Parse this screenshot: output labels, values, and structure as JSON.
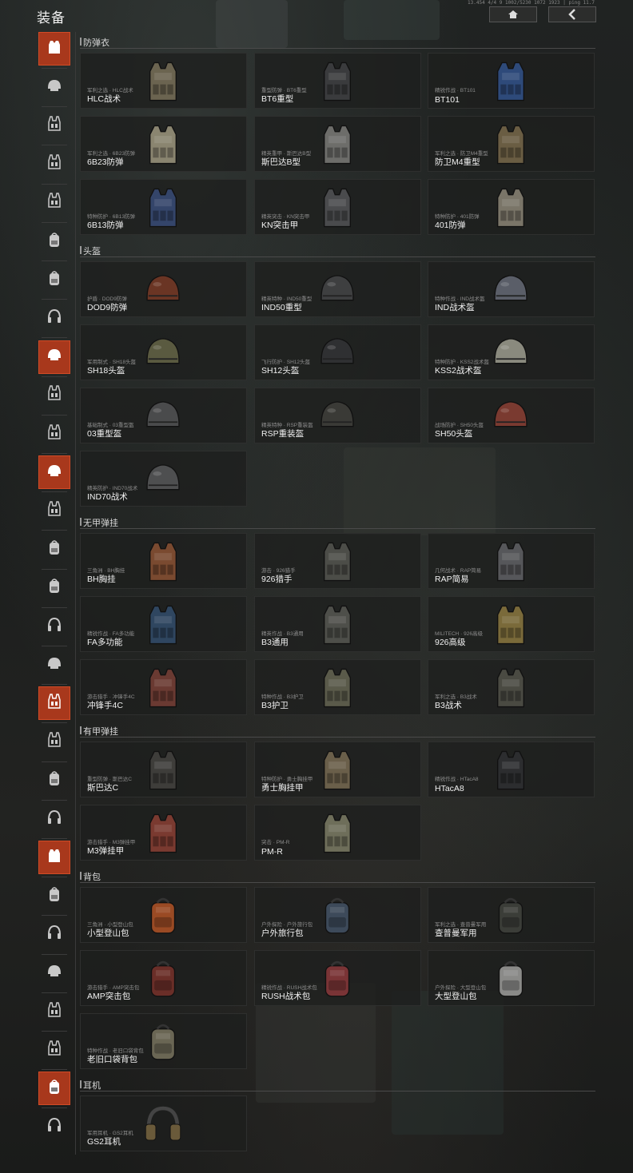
{
  "header": {
    "title": "装备",
    "status_text": "13.454 4/4 9 1002/5230 1072 1923 | ping 11.7"
  },
  "nav": {
    "home_icon": "home-icon",
    "back_icon": "back-arrow-icon"
  },
  "colors": {
    "accent": "#a8381c",
    "accent_border": "#d24b26",
    "panel": "#1e1f1e"
  },
  "sidebar": [
    {
      "icon": "vest-icon",
      "active": true
    },
    {
      "icon": "helmet-icon",
      "active": false
    },
    {
      "icon": "rig-icon",
      "active": false
    },
    {
      "icon": "rig-icon",
      "active": false
    },
    {
      "icon": "rig-icon",
      "active": false
    },
    {
      "icon": "backpack-icon",
      "active": false
    },
    {
      "icon": "backpack-icon",
      "active": false
    },
    {
      "icon": "headset-icon",
      "active": false
    },
    {
      "icon": "helmet-icon",
      "active": true
    },
    {
      "icon": "rig-icon",
      "active": false
    },
    {
      "icon": "rig-icon",
      "active": false
    },
    {
      "icon": "helmet-icon",
      "active": true
    },
    {
      "icon": "rig-icon",
      "active": false
    },
    {
      "icon": "backpack-icon",
      "active": false
    },
    {
      "icon": "backpack-icon",
      "active": false
    },
    {
      "icon": "headset-icon",
      "active": false
    },
    {
      "icon": "helmet-icon",
      "active": false
    },
    {
      "icon": "rig-icon",
      "active": true
    },
    {
      "icon": "rig-icon",
      "active": false
    },
    {
      "icon": "backpack-icon",
      "active": false
    },
    {
      "icon": "headset-icon",
      "active": false
    },
    {
      "icon": "vest-icon",
      "active": true
    },
    {
      "icon": "backpack-icon",
      "active": false
    },
    {
      "icon": "headset-icon",
      "active": false
    },
    {
      "icon": "helmet-icon",
      "active": false
    },
    {
      "icon": "rig-icon",
      "active": false
    },
    {
      "icon": "rig-icon",
      "active": false
    },
    {
      "icon": "backpack-icon",
      "active": true
    },
    {
      "icon": "headset-icon",
      "active": false
    }
  ],
  "sections": [
    {
      "title": "防弹衣",
      "items": [
        {
          "sub": "军利之选 · HLC战术",
          "name": "HLC战术",
          "color": "#6b6450"
        },
        {
          "sub": "重型防弹 · BT6重型",
          "name": "BT6重型",
          "color": "#3a3b3d"
        },
        {
          "sub": "精锐作战 · BT101",
          "name": "BT101",
          "color": "#2e4a7a"
        },
        {
          "sub": "军利之选 · 6B23防弹",
          "name": "6B23防弹",
          "color": "#8a8570"
        },
        {
          "sub": "精英重甲 · 斯巴达B型",
          "name": "斯巴达B型",
          "color": "#6d6d6a"
        },
        {
          "sub": "军利之选 · 防卫M4重型",
          "name": "防卫M4重型",
          "color": "#6a5d43"
        },
        {
          "sub": "特种防护 · 6B13防弹",
          "name": "6B13防弹",
          "color": "#34456a"
        },
        {
          "sub": "精英突击 · KN突击甲",
          "name": "KN突击甲",
          "color": "#4a4b4d"
        },
        {
          "sub": "特种防护 · 401防弹",
          "name": "401防弹",
          "color": "#7a7568"
        }
      ]
    },
    {
      "title": "头盔",
      "items": [
        {
          "sub": "护盾 · DOD9防弹",
          "name": "DOD9防弹",
          "color": "#6a3524"
        },
        {
          "sub": "精英特种 · IND50重型",
          "name": "IND50重型",
          "color": "#3e3f40"
        },
        {
          "sub": "特种作战 · IND战术盔",
          "name": "IND战术盔",
          "color": "#5a5e68"
        },
        {
          "sub": "军用制式 · SH18头盔",
          "name": "SH18头盔",
          "color": "#5a5a40"
        },
        {
          "sub": "飞行防护 · SH12头盔",
          "name": "SH12头盔",
          "color": "#2f3032"
        },
        {
          "sub": "特种防护 · KSS2战术盔",
          "name": "KSS2战术盔",
          "color": "#8a8a7e"
        },
        {
          "sub": "基础制式 · 03重型盔",
          "name": "03重型盔",
          "color": "#4a4b4c"
        },
        {
          "sub": "精英特种 · RSP重装盔",
          "name": "RSP重装盔",
          "color": "#3a3a36"
        },
        {
          "sub": "战场防护 · SH50头盔",
          "name": "SH50头盔",
          "color": "#7a3a30"
        },
        {
          "sub": "精英防护 · IND70战术",
          "name": "IND70战术",
          "color": "#4e4f50"
        }
      ]
    },
    {
      "title": "无甲弹挂",
      "items": [
        {
          "sub": "三角洲 · BH胸挂",
          "name": "BH胸挂",
          "color": "#7a4a30"
        },
        {
          "sub": "游击 · 926猎手",
          "name": "926猎手",
          "color": "#4c4d48"
        },
        {
          "sub": "几何战术 · RAP简易",
          "name": "RAP简易",
          "color": "#56575a"
        },
        {
          "sub": "精锐作战 · FA多功能",
          "name": "FA多功能",
          "color": "#2f4660"
        },
        {
          "sub": "精英作战 · B3通用",
          "name": "B3通用",
          "color": "#4e4f4a"
        },
        {
          "sub": "MILITECH · 926高级",
          "name": "926高级",
          "color": "#7a6a3a"
        },
        {
          "sub": "游击猎手 · 冲锋手4C",
          "name": "冲锋手4C",
          "color": "#6a3a32"
        },
        {
          "sub": "特种作战 · B3护卫",
          "name": "B3护卫",
          "color": "#5a5a4a"
        },
        {
          "sub": "军利之选 · B3战术",
          "name": "B3战术",
          "color": "#4a4a42"
        }
      ]
    },
    {
      "title": "有甲弹挂",
      "items": [
        {
          "sub": "重型防弹 · 斯巴达C",
          "name": "斯巴达C",
          "color": "#3e3d3a"
        },
        {
          "sub": "特种防护 · 勇士胸挂甲",
          "name": "勇士胸挂甲",
          "color": "#6a5f4a"
        },
        {
          "sub": "精锐作战 · HTacA8",
          "name": "HTacA8",
          "color": "#2c2d2f"
        },
        {
          "sub": "游击猎手 · M3弹挂甲",
          "name": "M3弹挂甲",
          "color": "#7a3a30"
        },
        {
          "sub": "突击 · PM-R",
          "name": "PM-R",
          "color": "#6e6e5a"
        }
      ]
    },
    {
      "title": "背包",
      "items": [
        {
          "sub": "三角洲 · 小型登山包",
          "name": "小型登山包",
          "color": "#9a4a24"
        },
        {
          "sub": "户外探险 · 户外旅行包",
          "name": "户外旅行包",
          "color": "#3d4a5a"
        },
        {
          "sub": "军利之选 · 查普曼军用",
          "name": "查普曼军用",
          "color": "#3b3d38"
        },
        {
          "sub": "游击猎手 · AMP突击包",
          "name": "AMP突击包",
          "color": "#6a2e28"
        },
        {
          "sub": "精锐作战 · RUSH战术包",
          "name": "RUSH战术包",
          "color": "#7a3436"
        },
        {
          "sub": "户外探险 · 大型登山包",
          "name": "大型登山包",
          "color": "#8a8a88"
        },
        {
          "sub": "特种作战 · 老旧口袋背包",
          "name": "老旧口袋背包",
          "color": "#6a6654"
        }
      ]
    },
    {
      "title": "耳机",
      "items": [
        {
          "sub": "军用耳机 · GS2耳机",
          "name": "GS2耳机",
          "color": "#6a5a3a"
        }
      ]
    }
  ]
}
